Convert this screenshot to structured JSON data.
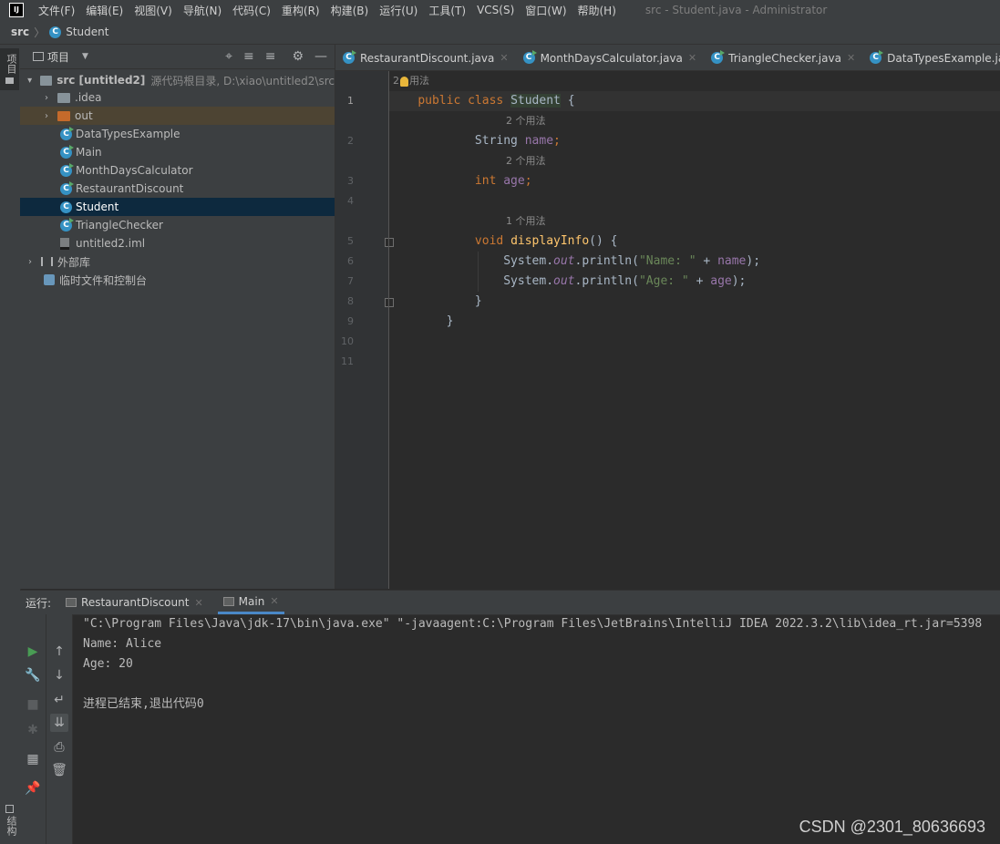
{
  "menubar": {
    "items": [
      "文件(F)",
      "编辑(E)",
      "视图(V)",
      "导航(N)",
      "代码(C)",
      "重构(R)",
      "构建(B)",
      "运行(U)",
      "工具(T)",
      "VCS(S)",
      "窗口(W)",
      "帮助(H)"
    ],
    "window_title": "src - Student.java - Administrator"
  },
  "breadcrumb": {
    "root": "src",
    "file": "Student"
  },
  "left_stripe": {
    "project": "项目",
    "structure": "结构"
  },
  "project_panel": {
    "title": "项目",
    "tree": {
      "root_name": "src [untitled2]",
      "root_hint": "源代码根目录, D:\\xiao\\untitled2\\src",
      "idea": ".idea",
      "out": "out",
      "files": [
        "DataTypesExample",
        "Main",
        "MonthDaysCalculator",
        "RestaurantDiscount",
        "Student",
        "TriangleChecker"
      ],
      "iml": "untitled2.iml",
      "external_libs": "外部库",
      "scratches": "临时文件和控制台"
    }
  },
  "editor": {
    "tabs": [
      "RestaurantDiscount.java",
      "MonthDaysCalculator.java",
      "TriangleChecker.java",
      "DataTypesExample.java"
    ],
    "hints": {
      "class_usages_count": "2",
      "class_usages_word": "用法",
      "name_usages": "2 个用法",
      "age_usages": "2 个用法",
      "method_usages": "1 个用法"
    },
    "line_numbers": [
      "1",
      "2",
      "3",
      "4",
      "5",
      "6",
      "7",
      "8",
      "9",
      "10",
      "11"
    ],
    "code": {
      "l1_kw1": "public",
      "l1_kw2": "class",
      "l1_name": "Student",
      "l1_brace": "{",
      "l2_type": "String",
      "l2_field": "name",
      "l3_type": "int",
      "l3_field": "age",
      "l5_kw": "void",
      "l5_fn": "displayInfo",
      "l5_rest": "() {",
      "l6_sys": "System.",
      "l6_out": "out",
      "l6_call": ".println(",
      "l6_str": "\"Name: \"",
      "l6_plus": " + ",
      "l6_field": "name",
      "l6_end": ");",
      "l7_sys": "System.",
      "l7_out": "out",
      "l7_call": ".println(",
      "l7_str": "\"Age: \"",
      "l7_plus": " + ",
      "l7_field": "age",
      "l7_end": ");",
      "l8": "}",
      "l9": "}"
    }
  },
  "run_panel": {
    "label": "运行:",
    "tabs": [
      "RestaurantDiscount",
      "Main"
    ],
    "console": [
      "\"C:\\Program Files\\Java\\jdk-17\\bin\\java.exe\" \"-javaagent:C:\\Program Files\\JetBrains\\IntelliJ IDEA 2022.3.2\\lib\\idea_rt.jar=5398",
      "Name: Alice",
      "Age: 20",
      "",
      "进程已结束,退出代码0"
    ]
  },
  "watermark": "CSDN @2301_80636693",
  "colors": {
    "keyword": "#cc7832",
    "field": "#9876aa",
    "method": "#ffc66d",
    "string": "#6a8759",
    "selection": "#0d293e",
    "class_icon": "#3592c4",
    "folder_out": "#c46a2b"
  },
  "icons": {
    "menubar": "intellij-logo",
    "tree_class": "class-icon",
    "run_buttons": [
      "run-icon",
      "wrench-icon",
      "stop-icon",
      "debug-icon",
      "layout-icon",
      "pin-icon"
    ],
    "console_buttons": [
      "arrow-up-icon",
      "arrow-down-icon",
      "soft-wrap-icon",
      "scroll-to-end-icon",
      "print-icon",
      "trash-icon"
    ]
  }
}
